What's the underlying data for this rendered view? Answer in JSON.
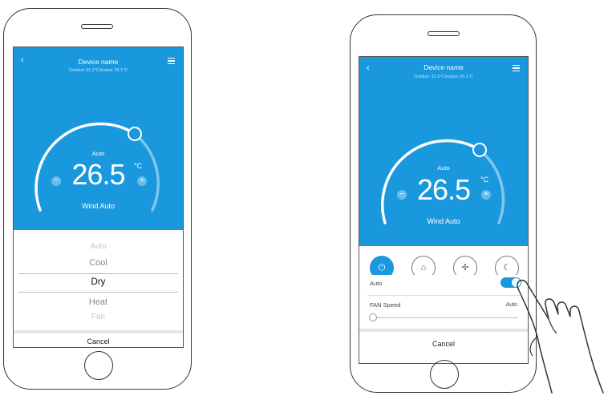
{
  "left_phone": {
    "header": {
      "title": "Device name",
      "subtitle": "Outdoor 31.2°C/Indoor 25.1°C"
    },
    "thermostat": {
      "mode": "Auto",
      "temperature": "26.5",
      "unit": "°C",
      "wind": "Wind Auto",
      "minus": "−",
      "plus": "+"
    },
    "picker": {
      "items": [
        "Auto",
        "Cool",
        "Dry",
        "Heat",
        "Fan"
      ],
      "selected": "Dry"
    },
    "cancel_label": "Cancel"
  },
  "right_phone": {
    "header": {
      "title": "Device name",
      "subtitle": "Outdoor 31.2°C/Indoor 25.1°C"
    },
    "thermostat": {
      "mode": "Auto",
      "temperature": "26.5",
      "unit": "°C",
      "wind": "Wind Auto",
      "minus": "−",
      "plus": "+"
    },
    "mode_buttons": [
      {
        "icon": "power-icon",
        "glyph": "⏻"
      },
      {
        "icon": "home-icon",
        "glyph": "⌂"
      },
      {
        "icon": "fan-icon",
        "glyph": "✢"
      },
      {
        "icon": "sleep-icon",
        "glyph": "☾"
      }
    ],
    "auto_row": {
      "label": "Auto",
      "toggle_on": true
    },
    "fan_speed": {
      "label": "FAN Speed",
      "value": "Auto",
      "level": 0
    },
    "cancel_label": "Cancel"
  },
  "colors": {
    "accent": "#1a98dd"
  }
}
